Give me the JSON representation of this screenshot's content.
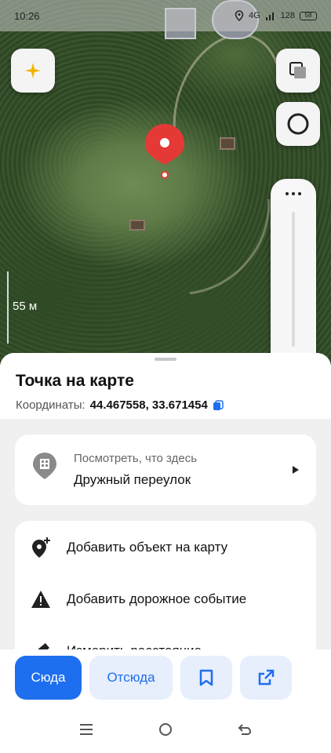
{
  "status_bar": {
    "time": "10:26",
    "network": "4G",
    "speed": "128",
    "battery": "58"
  },
  "map": {
    "scale_label": "55 м"
  },
  "icons": {
    "ai": "sparkle-icon",
    "layers": "layers-icon",
    "alice": "alice-icon",
    "more": "more-icon",
    "no_route": "no-route-icon",
    "bell": "bell-icon",
    "building": "building-icon",
    "add_object": "add-place-icon",
    "road_event": "warning-icon",
    "ruler": "ruler-icon",
    "bookmark": "bookmark-icon",
    "share": "share-icon"
  },
  "sheet": {
    "title": "Точка на карте",
    "coords_label": "Координаты:",
    "coords_value": "44.467558, 33.671454",
    "what_here_label": "Посмотреть, что здесь",
    "what_here_value": "Дружный переулок",
    "actions": [
      {
        "label": "Добавить объект на карту"
      },
      {
        "label": "Добавить дорожное событие"
      },
      {
        "label": "Измерить расстояние"
      }
    ]
  },
  "buttons": {
    "here": "Сюда",
    "from_here": "Отсюда"
  },
  "colors": {
    "accent": "#1e6ef0",
    "accent_light": "#e7eefc",
    "pin": "#e53935"
  }
}
